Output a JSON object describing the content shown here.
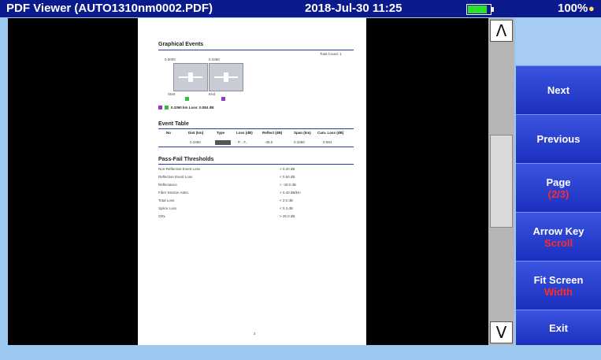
{
  "status": {
    "title": "PDF Viewer (AUTO1310nm0002.PDF)",
    "datetime": "2018-Jul-30 11:25",
    "battery_level": 0.85,
    "battery_pct": "100%",
    "bulb_icon": "lightbulb-icon"
  },
  "pdf": {
    "graphical_events_title": "Graphical Events",
    "total_count": "Total Count: 1",
    "dist_a": "0.0000",
    "dist_b": "0.3360",
    "ev_a_label": "Start",
    "ev_b_label": "End",
    "span_summary": "0.3360 km   Loss: 0.084 dB",
    "event_table_title": "Event Table",
    "event_table_headers": [
      "No",
      "Dist (km)",
      "Type",
      "Loss (dB)",
      "Reflect (dB)",
      "Span (km)",
      "Cum. Loss (dB)"
    ],
    "event_row": [
      "",
      "0.3360",
      "",
      "P... F..",
      "-45.0",
      "0.3360",
      "0.084"
    ],
    "passfail_title": "Pass-Fail Thresholds",
    "thresholds": [
      [
        "Non-Reflective Event Loss",
        "< 0.20 dB"
      ],
      [
        "Reflective Event Loss",
        "< 0.50 dB"
      ],
      [
        "Reflectance",
        "> -40.0 dB"
      ],
      [
        "Fiber Section Atten.",
        "< 0.40 dB/km"
      ],
      [
        "Total Loss",
        "< 3.0 dB"
      ],
      [
        "Splice Loss",
        "< 0.3 dB"
      ],
      [
        "ORL",
        "> 25.0 dB"
      ]
    ],
    "page_number": "2"
  },
  "scrollbar": {
    "up": "^",
    "down": "v"
  },
  "softkeys": {
    "next": "Next",
    "previous": "Previous",
    "page_label": "Page",
    "page_value": "(2/3)",
    "arrow_key_label": "Arrow Key",
    "arrow_key_value": "Scroll",
    "fit_screen_label": "Fit Screen",
    "fit_screen_value": "Width",
    "exit": "Exit"
  },
  "colors": {
    "title_bg": "#0a1a8c",
    "key_bg": "#2a44d4",
    "accent_red": "#ff2a2a",
    "rule_blue": "#2a3ba8"
  }
}
